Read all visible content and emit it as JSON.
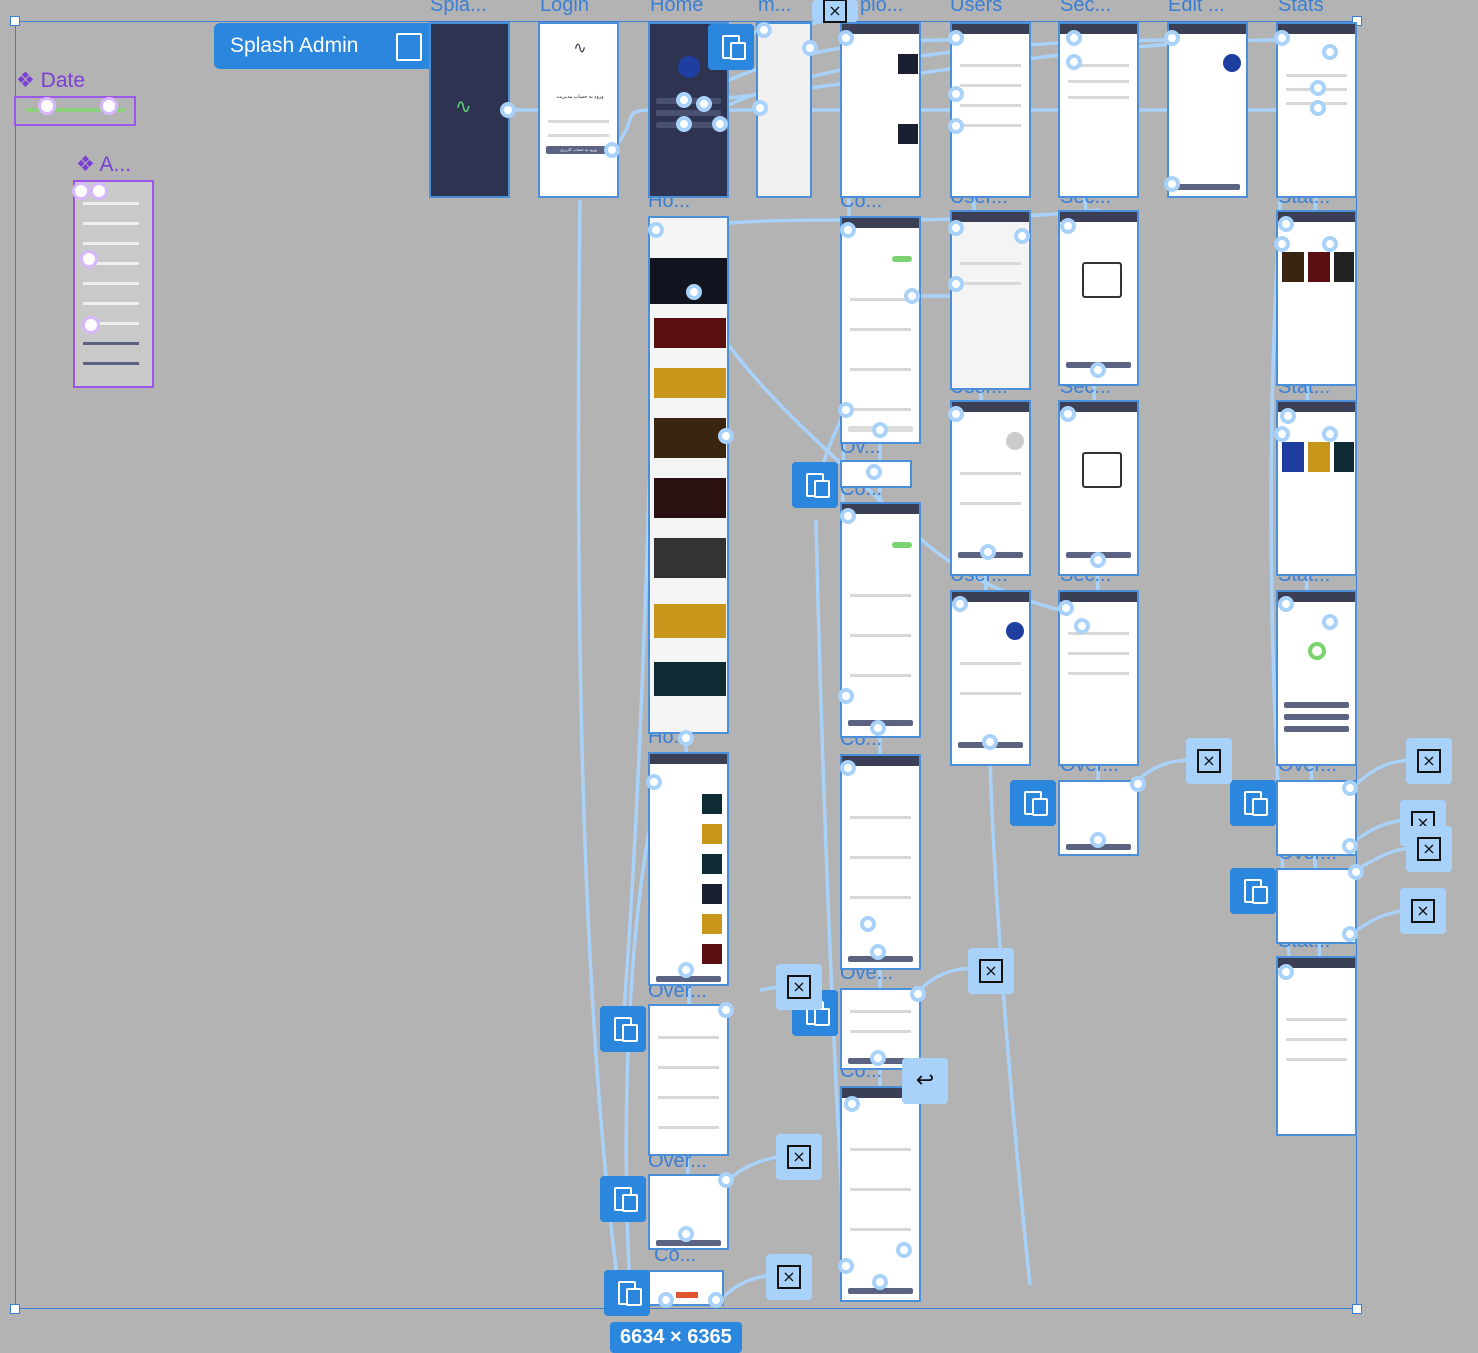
{
  "flow_start": {
    "label": "Splash Admin",
    "icon": "play-flow-icon"
  },
  "dimensions_badge": "6634 × 6365",
  "components": [
    {
      "label": "Date",
      "icon": "component-diamond-icon"
    },
    {
      "label": "A...",
      "icon": "component-diamond-icon"
    }
  ],
  "frame_titles": {
    "splash": "Spla...",
    "login": "Login",
    "home": "Home",
    "menu": "m...",
    "uploads": "plo...",
    "users": "Users",
    "sec": "Sec...",
    "edit": "Edit ...",
    "stats": "Stats",
    "home2": "Ho...",
    "home3": "Ho...",
    "con1": "Co...",
    "over_c1": "Ov...",
    "con2": "Co...",
    "con3": "Co...",
    "over_c2": "Ove...",
    "con4": "Co...",
    "user2": "User...",
    "user3": "User...",
    "user4": "User...",
    "sec2": "Sec...",
    "sec3": "Sec...",
    "sec4": "Sec...",
    "over_s": "Over...",
    "stat2": "Stat...",
    "stat3": "Stat...",
    "stat4": "Stat...",
    "over_st1": "Over...",
    "over_st2": "Over...",
    "stat5": "Stat...",
    "over_h1": "Over...",
    "over_h2": "Over...",
    "con_h": "Co..."
  },
  "login_screen": {
    "heading": "ورود به حساب مدیریت",
    "button": "ورود به حساب کاربری"
  },
  "colors": {
    "canvas": "#b3b3b3",
    "selection": "#3a7fd5",
    "prototype_link": "#a9d2fa",
    "overlay_action": "#2b86de",
    "component": "#9b57e9"
  }
}
